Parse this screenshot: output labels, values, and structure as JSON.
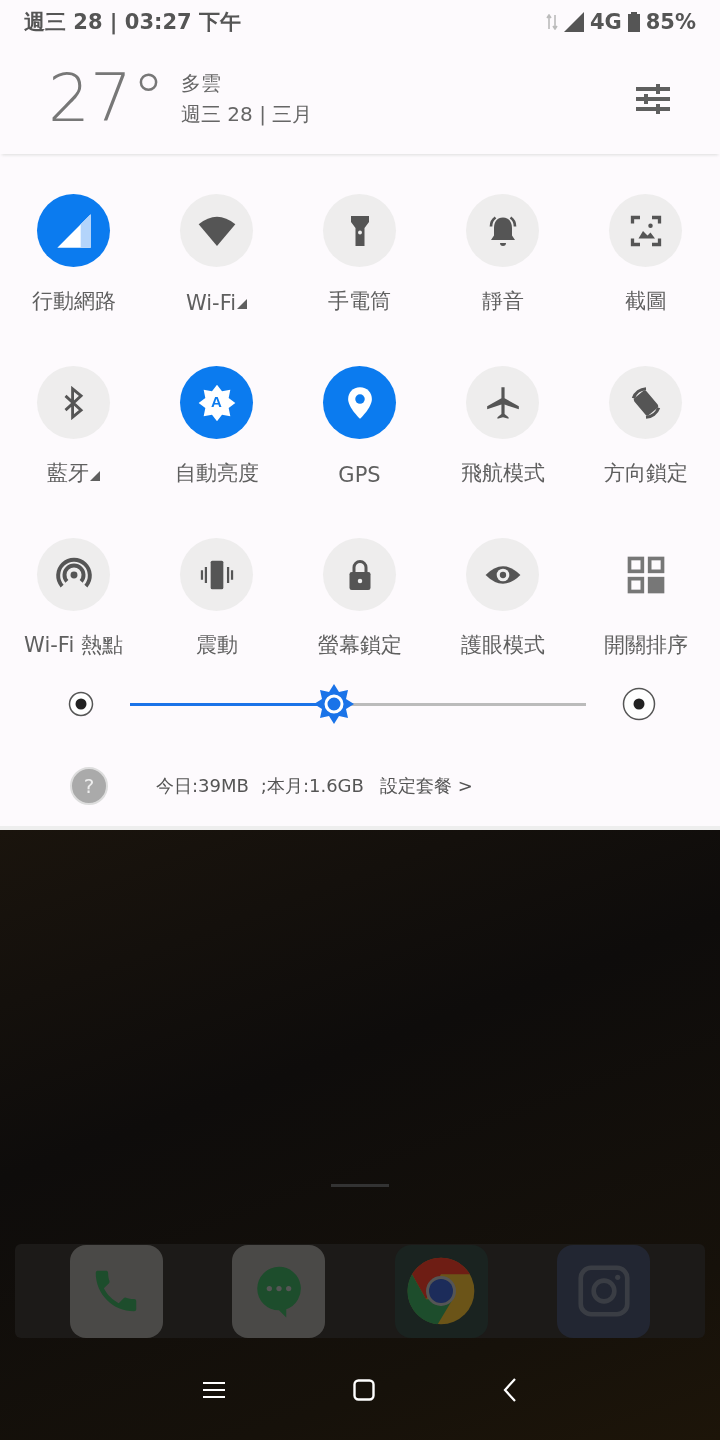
{
  "status_bar": {
    "time": "週三 28 | 03:27 下午",
    "network": "4G",
    "battery": "85%"
  },
  "header": {
    "temperature": "27°",
    "weather": "多雲",
    "date": "週三 28 | 三月"
  },
  "tiles": [
    {
      "kind": "cellular",
      "label": "行動網路",
      "on": true,
      "dropdown": false
    },
    {
      "kind": "wifi",
      "label": "Wi-Fi",
      "on": false,
      "dropdown": true
    },
    {
      "kind": "flashlight",
      "label": "手電筒",
      "on": false,
      "dropdown": false
    },
    {
      "kind": "bell",
      "label": "靜音",
      "on": false,
      "dropdown": false
    },
    {
      "kind": "screenshot",
      "label": "截圖",
      "on": false,
      "dropdown": false
    },
    {
      "kind": "bluetooth",
      "label": "藍牙",
      "on": false,
      "dropdown": true
    },
    {
      "kind": "brightness",
      "label": "自動亮度",
      "on": true,
      "dropdown": false,
      "badge": "A"
    },
    {
      "kind": "location",
      "label": "GPS",
      "on": true,
      "dropdown": false
    },
    {
      "kind": "airplane",
      "label": "飛航模式",
      "on": false,
      "dropdown": false
    },
    {
      "kind": "rotation",
      "label": "方向鎖定",
      "on": false,
      "dropdown": false
    },
    {
      "kind": "hotspot",
      "label": "Wi-Fi 熱點",
      "on": false,
      "dropdown": false
    },
    {
      "kind": "vibrate",
      "label": "震動",
      "on": false,
      "dropdown": false
    },
    {
      "kind": "lock",
      "label": "螢幕鎖定",
      "on": false,
      "dropdown": false
    },
    {
      "kind": "eye",
      "label": "護眼模式",
      "on": false,
      "dropdown": false
    },
    {
      "kind": "edit",
      "label": "開關排序",
      "on": false,
      "dropdown": false
    }
  ],
  "brightness": {
    "level": 0.447
  },
  "data_usage": {
    "help": "?",
    "today": "今日:39MB",
    "month": ";本月:1.6GB",
    "link": "設定套餐 >"
  },
  "dock": [
    {
      "kind": "phone"
    },
    {
      "kind": "messages"
    },
    {
      "kind": "browser"
    },
    {
      "kind": "camera"
    }
  ]
}
